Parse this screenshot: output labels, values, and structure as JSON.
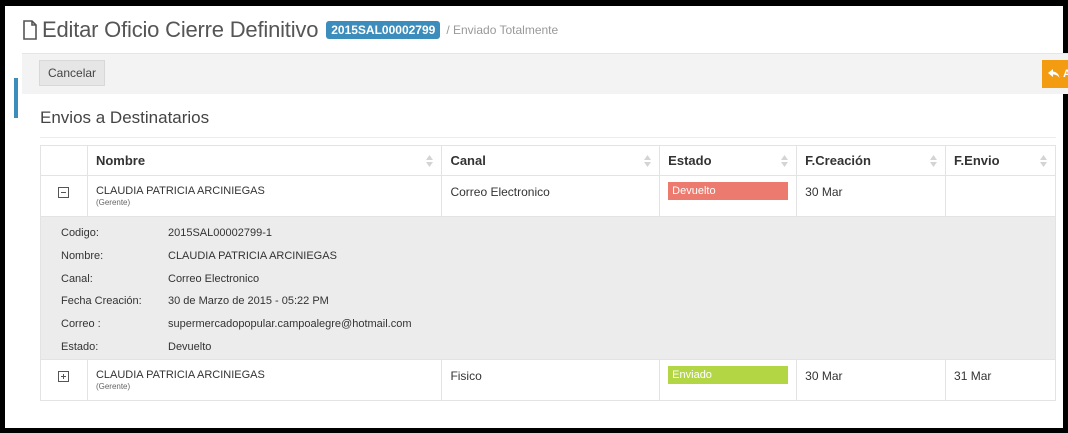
{
  "header": {
    "title": "Editar Oficio Cierre Definitivo",
    "code_badge": "2015SAL00002799",
    "status_suffix": "/ Enviado Totalmente"
  },
  "toolbar": {
    "cancel_label": "Cancelar",
    "action_label": "Ac"
  },
  "section": {
    "title": "Envios a Destinatarios"
  },
  "table": {
    "headers": [
      "Nombre",
      "Canal",
      "Estado",
      "F.Creación",
      "F.Envio"
    ],
    "rows": [
      {
        "name": "CLAUDIA PATRICIA ARCINIEGAS",
        "role": "(Gerente)",
        "canal": "Correo Electronico",
        "estado": "Devuelto",
        "estado_color": "#ec7a6e",
        "f_creacion": "30 Mar",
        "f_envio": "",
        "expanded": true
      },
      {
        "name": "CLAUDIA PATRICIA ARCINIEGAS",
        "role": "(Gerente)",
        "canal": "Fisico",
        "estado": "Enviado",
        "estado_color": "#b3d645",
        "f_creacion": "30 Mar",
        "f_envio": "31 Mar",
        "expanded": false
      }
    ],
    "detail": {
      "labels": [
        "Codigo:",
        "Nombre:",
        "Canal:",
        "Fecha Creación:",
        "Correo :",
        "Estado:"
      ],
      "values": [
        "2015SAL00002799-1",
        "CLAUDIA PATRICIA ARCINIEGAS",
        "Correo Electronico",
        "30 de Marzo de 2015 - 05:22 PM",
        "supermercadopopular.campoalegre@hotmail.com",
        "Devuelto"
      ]
    }
  },
  "colors": {
    "accent": "#3c8dbc",
    "warning": "#f39c12"
  }
}
